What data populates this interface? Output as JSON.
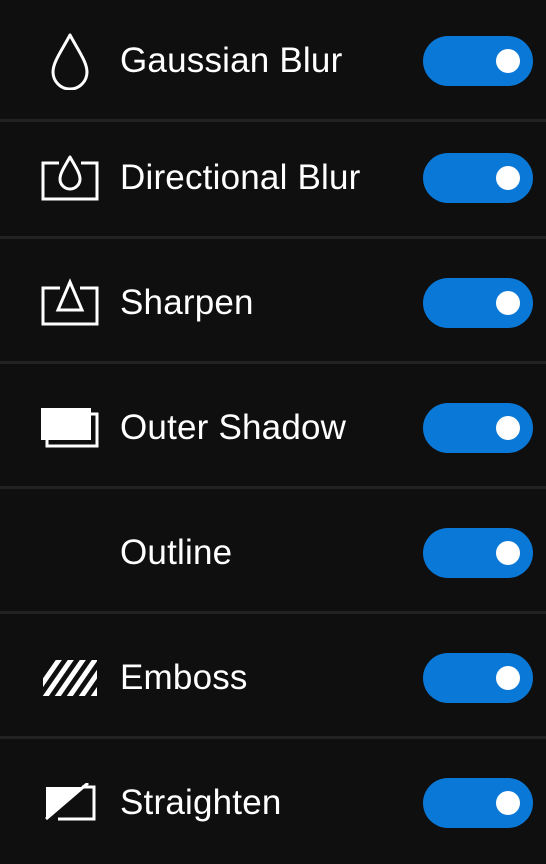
{
  "accent_color": "#0a78d7",
  "effects": [
    {
      "label": "Gaussian Blur",
      "icon": "drop-icon",
      "enabled": true
    },
    {
      "label": "Directional Blur",
      "icon": "drop-in-frame-icon",
      "enabled": true
    },
    {
      "label": "Sharpen",
      "icon": "triangle-in-frame-icon",
      "enabled": true
    },
    {
      "label": "Outer Shadow",
      "icon": "stacked-rectangles-icon",
      "enabled": true
    },
    {
      "label": "Outline",
      "icon": "",
      "enabled": true
    },
    {
      "label": "Emboss",
      "icon": "diagonal-stripes-icon",
      "enabled": true
    },
    {
      "label": "Straighten",
      "icon": "slashed-frame-icon",
      "enabled": true
    }
  ]
}
